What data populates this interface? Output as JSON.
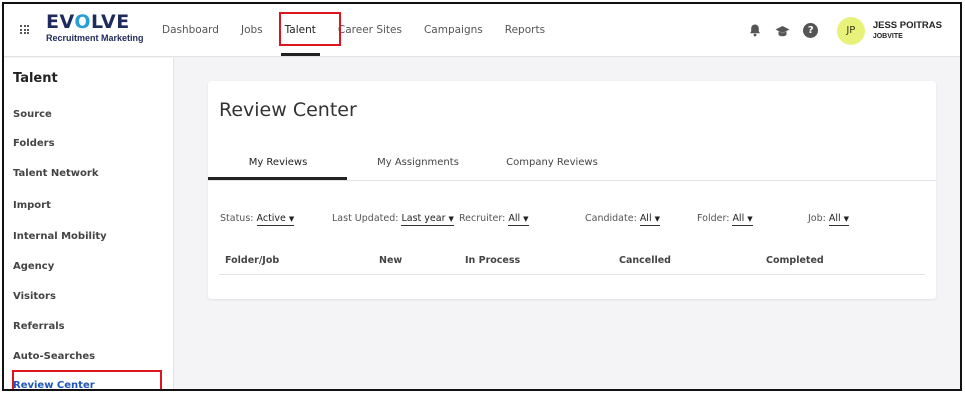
{
  "brand": {
    "logo_main_a": "EV",
    "logo_main_accent": "O",
    "logo_main_b": "LVE",
    "logo_sub": "Recruitment Marketing"
  },
  "nav": {
    "items": [
      {
        "label": "Dashboard"
      },
      {
        "label": "Jobs"
      },
      {
        "label": "Talent",
        "active": true
      },
      {
        "label": "Career Sites"
      },
      {
        "label": "Campaigns"
      },
      {
        "label": "Reports"
      }
    ],
    "user": {
      "initials": "JP",
      "name": "JESS POITRAS",
      "org": "JOBVITE"
    },
    "icons": [
      "bell-icon",
      "graduation-cap-icon",
      "help-icon"
    ]
  },
  "sidebar": {
    "title": "Talent",
    "items": [
      {
        "label": "Source"
      },
      {
        "label": "Folders"
      },
      {
        "label": "Talent Network"
      },
      {
        "label": "Import"
      },
      {
        "label": "Internal Mobility"
      },
      {
        "label": "Agency"
      },
      {
        "label": "Visitors"
      },
      {
        "label": "Referrals"
      },
      {
        "label": "Auto-Searches"
      },
      {
        "label": "Review Center",
        "active": true
      }
    ]
  },
  "main": {
    "title": "Review Center",
    "tabs": [
      {
        "label": "My Reviews",
        "active": true
      },
      {
        "label": "My Assignments"
      },
      {
        "label": "Company Reviews"
      }
    ],
    "filters": [
      {
        "label": "Status:",
        "value": "Active"
      },
      {
        "label": "Last Updated:",
        "value": "Last year"
      },
      {
        "label": "Recruiter:",
        "value": "All"
      },
      {
        "label": "Candidate:",
        "value": "All"
      },
      {
        "label": "Folder:",
        "value": "All"
      },
      {
        "label": "Job:",
        "value": "All"
      }
    ],
    "columns": [
      "Folder/Job",
      "New",
      "In Process",
      "Cancelled",
      "Completed"
    ]
  },
  "colors": {
    "highlight": "#e0141e",
    "accent": "#1f56b8",
    "avatar_bg": "#e8f27a"
  }
}
